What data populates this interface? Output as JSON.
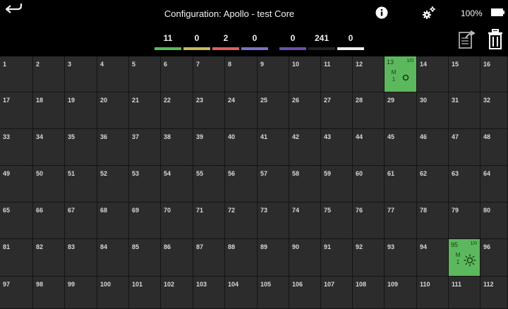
{
  "header": {
    "title": "Configuration: Apollo - test Core",
    "battery": "100%",
    "back_icon": "back-arrow-icon",
    "info_icon": "info-icon",
    "settings_icon": "gears-icon"
  },
  "counters": [
    {
      "value": "11",
      "color": "#5cb85c"
    },
    {
      "value": "0",
      "color": "#c8bb5a"
    },
    {
      "value": "2",
      "color": "#e06060"
    },
    {
      "value": "0",
      "color": "#7a72c8"
    },
    {
      "value": "0",
      "color": "#6a50b0"
    },
    {
      "value": "241",
      "color": "#222222"
    },
    {
      "value": "0",
      "color": "#f0f0f0"
    }
  ],
  "toolbar": {
    "export_icon": "export-icon",
    "trash_icon": "trash-icon"
  },
  "grid": {
    "rows": [
      [
        "1",
        "2",
        "3",
        "4",
        "5",
        "6",
        "7",
        "8",
        "9",
        "10",
        "11",
        "12",
        "13",
        "14",
        "15",
        "16"
      ],
      [
        "17",
        "18",
        "19",
        "20",
        "21",
        "22",
        "23",
        "24",
        "25",
        "26",
        "27",
        "28",
        "29",
        "30",
        "31",
        "32"
      ],
      [
        "33",
        "34",
        "35",
        "36",
        "37",
        "38",
        "39",
        "40",
        "41",
        "42",
        "43",
        "44",
        "45",
        "46",
        "47",
        "48"
      ],
      [
        "49",
        "50",
        "51",
        "52",
        "53",
        "54",
        "55",
        "56",
        "57",
        "58",
        "59",
        "60",
        "61",
        "62",
        "63",
        "64"
      ],
      [
        "65",
        "66",
        "67",
        "68",
        "69",
        "70",
        "71",
        "72",
        "73",
        "74",
        "75",
        "76",
        "77",
        "78",
        "79",
        "80"
      ],
      [
        "81",
        "82",
        "83",
        "84",
        "85",
        "86",
        "87",
        "88",
        "89",
        "90",
        "91",
        "92",
        "93",
        "94",
        "95",
        "96"
      ],
      [
        "97",
        "98",
        "99",
        "100",
        "101",
        "102",
        "103",
        "104",
        "105",
        "106",
        "107",
        "108",
        "109",
        "110",
        "111",
        "112"
      ]
    ],
    "active": [
      {
        "id": "13",
        "io": "1/0",
        "mode": "M",
        "index": "1",
        "device": "circle",
        "color": "#5cb85c"
      },
      {
        "id": "95",
        "io": "1/0",
        "mode": "M",
        "index": "1",
        "device": "sun",
        "color": "#5cb85c"
      }
    ]
  }
}
